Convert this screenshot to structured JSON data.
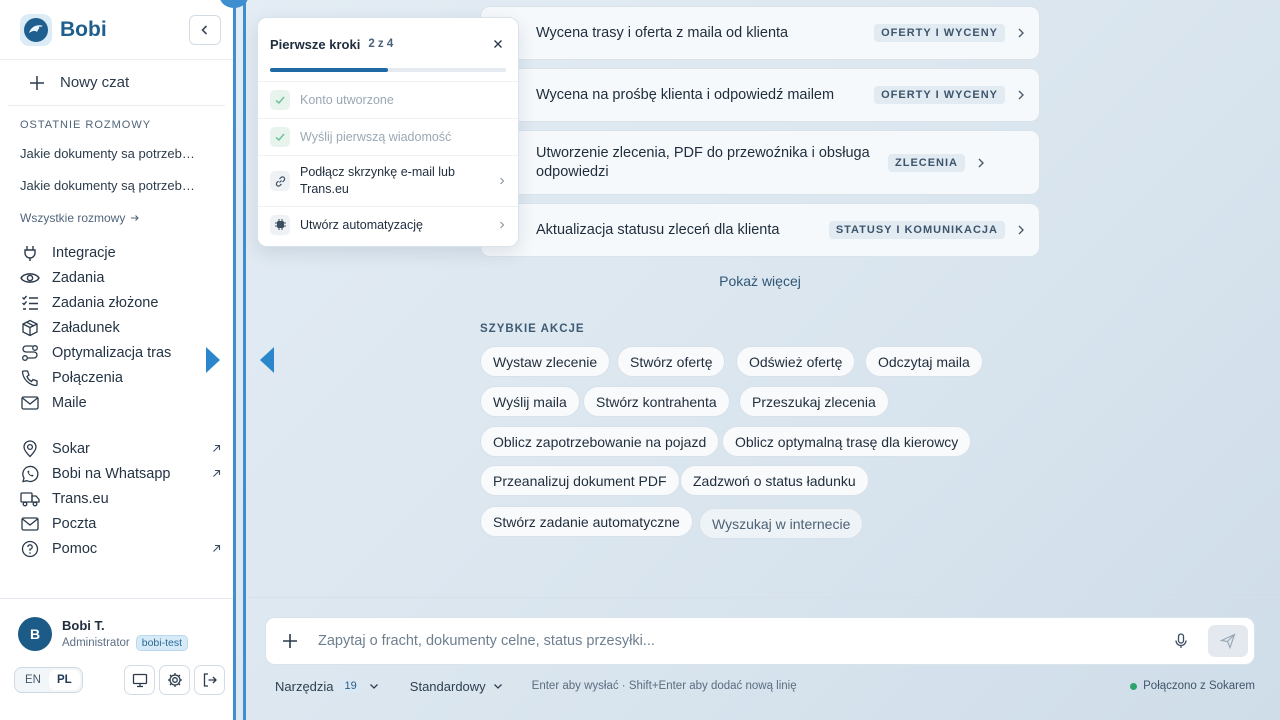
{
  "sidebar": {
    "brand": "Bobi",
    "new_chat": "Nowy czat",
    "recent_label": "OSTATNIE ROZMOWY",
    "recent": [
      "Jakie dokumenty sa potrzebne do odprawy",
      "Jakie dokumenty są potrzebne do odprawy"
    ],
    "all_chats": "Wszystkie rozmowy",
    "nav": [
      {
        "label": "Integracje",
        "icon": "plug-icon"
      },
      {
        "label": "Zadania",
        "icon": "eye-icon"
      },
      {
        "label": "Zadania złożone",
        "icon": "checklist-icon"
      },
      {
        "label": "Załadunek",
        "icon": "package-icon"
      },
      {
        "label": "Optymalizacja tras",
        "icon": "route-icon"
      },
      {
        "label": "Połączenia",
        "icon": "phone-icon"
      },
      {
        "label": "Maile",
        "icon": "mail-icon"
      }
    ],
    "external": [
      {
        "label": "Sokar",
        "icon": "location-icon"
      },
      {
        "label": "Bobi na Whatsapp",
        "icon": "whatsapp-icon"
      },
      {
        "label": "Trans.eu",
        "icon": "truck-icon"
      },
      {
        "label": "Poczta",
        "icon": "mail-icon"
      },
      {
        "label": "Pomoc",
        "icon": "help-icon"
      }
    ],
    "user": {
      "initial": "B",
      "name": "Bobi T.",
      "role": "Administrator",
      "tenant": "bobi-test"
    },
    "lang": {
      "en": "EN",
      "pl": "PL",
      "active": "PL"
    }
  },
  "onboarding": {
    "title": "Pierwsze kroki",
    "count": "2 z 4",
    "progress": 0.5,
    "steps": [
      {
        "label": "Konto utworzone",
        "done": true
      },
      {
        "label": "Wyślij pierwszą wiadomość",
        "done": true
      },
      {
        "label": "Podłącz skrzynkę e-mail lub Trans.eu",
        "done": false
      },
      {
        "label": "Utwórz automatyzację",
        "done": false
      }
    ]
  },
  "tasks": [
    {
      "title": "Wycena trasy i oferta z maila od klienta",
      "category": "OFERTY I WYCENY"
    },
    {
      "title": "Wycena na prośbę klienta i odpowiedź mailem",
      "category": "OFERTY I WYCENY"
    },
    {
      "title": "Utworzenie zlecenia, PDF do przewoźnika i obsługa odpowiedzi",
      "category": "ZLECENIA"
    },
    {
      "title": "Aktualizacja statusu zleceń dla klienta",
      "category": "STATUSY I KOMUNIKACJA"
    }
  ],
  "show_more": "Pokaż więcej",
  "quick_actions": {
    "label": "SZYBKIE AKCJE",
    "items": [
      "Wystaw zlecenie",
      "Stwórz ofertę",
      "Odśwież ofertę",
      "Odczytaj maila",
      "Wyślij maila",
      "Stwórz kontrahenta",
      "Przeszukaj zlecenia",
      "Oblicz zapotrzebowanie na pojazd",
      "Oblicz optymalną trasę dla kierowcy",
      "Przeanalizuj dokument PDF",
      "Zadzwoń o status ładunku",
      "Stwórz zadanie automatyczne",
      "Wyszukaj w internecie"
    ]
  },
  "composer": {
    "placeholder": "Zapytaj o fracht, dokumenty celne, status przesyłki...",
    "tools_label": "Narzędzia",
    "tools_count": "19",
    "mode": "Standardowy",
    "hint": "Enter aby wysłać · Shift+Enter aby dodać nową linię",
    "status": "Połączono z Sokarem"
  },
  "colors": {
    "accent": "#1f6aa5",
    "brand": "#1e5f8e",
    "stripe": "#3f8fd0",
    "status_ok": "#2ea36b"
  }
}
